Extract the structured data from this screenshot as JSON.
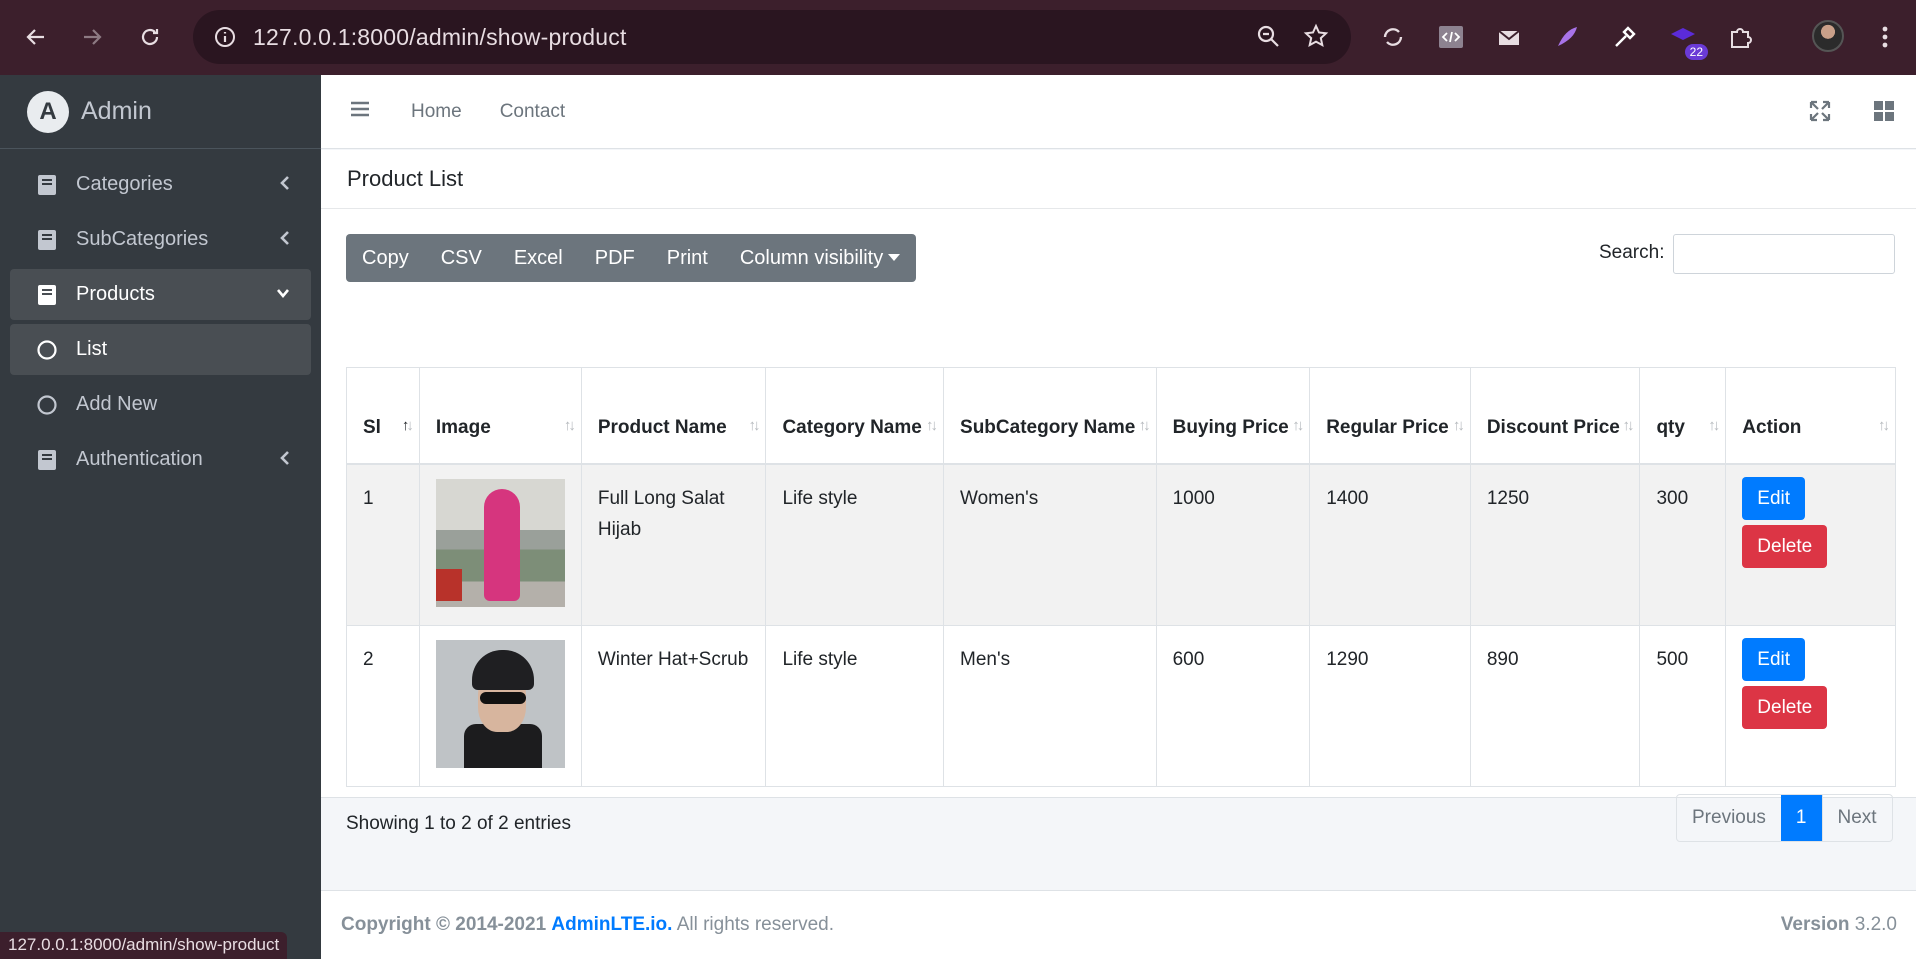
{
  "browser": {
    "url": "127.0.0.1:8000/admin/show-product",
    "extension_badge": "22",
    "status_url": "127.0.0.1:8000/admin/show-product"
  },
  "sidebar": {
    "brand": "Admin",
    "items": [
      {
        "label": "Categories",
        "icon": "book-icon"
      },
      {
        "label": "SubCategories",
        "icon": "book-icon"
      },
      {
        "label": "Products",
        "icon": "book-icon"
      },
      {
        "label": "List",
        "icon": "circle-icon"
      },
      {
        "label": "Add New",
        "icon": "circle-icon"
      },
      {
        "label": "Authentication",
        "icon": "book-icon"
      }
    ]
  },
  "topnav": {
    "home": "Home",
    "contact": "Contact"
  },
  "card": {
    "title": "Product List",
    "buttons": [
      "Copy",
      "CSV",
      "Excel",
      "PDF",
      "Print",
      "Column visibility"
    ],
    "search_label": "Search:",
    "search_value": ""
  },
  "table": {
    "headers": [
      "Sl",
      "Image",
      "Product Name",
      "Category Name",
      "SubCategory Name",
      "Buying Price",
      "Regular Price",
      "Discount Price",
      "qty",
      "Action"
    ],
    "rows": [
      {
        "sl": "1",
        "name": "Full Long Salat Hijab",
        "category": "Life style",
        "subcategory": "Women's",
        "buying": "1000",
        "regular": "1400",
        "discount": "1250",
        "qty": "300"
      },
      {
        "sl": "2",
        "name": "Winter Hat+Scrub",
        "category": "Life style",
        "subcategory": "Men's",
        "buying": "600",
        "regular": "1290",
        "discount": "890",
        "qty": "500"
      }
    ],
    "edit_label": "Edit",
    "delete_label": "Delete"
  },
  "pagination": {
    "info": "Showing 1 to 2 of 2 entries",
    "previous": "Previous",
    "current": "1",
    "next": "Next"
  },
  "footer": {
    "copyright_prefix": "Copyright © 2014-2021",
    "copyright_link": "AdminLTE.io.",
    "copyright_suffix": "All rights reserved.",
    "version_label": "Version",
    "version": "3.2.0"
  },
  "colors": {
    "primary": "#007bff",
    "danger": "#dc3545",
    "sidebar": "#343a40",
    "button_group": "#6c757d"
  }
}
